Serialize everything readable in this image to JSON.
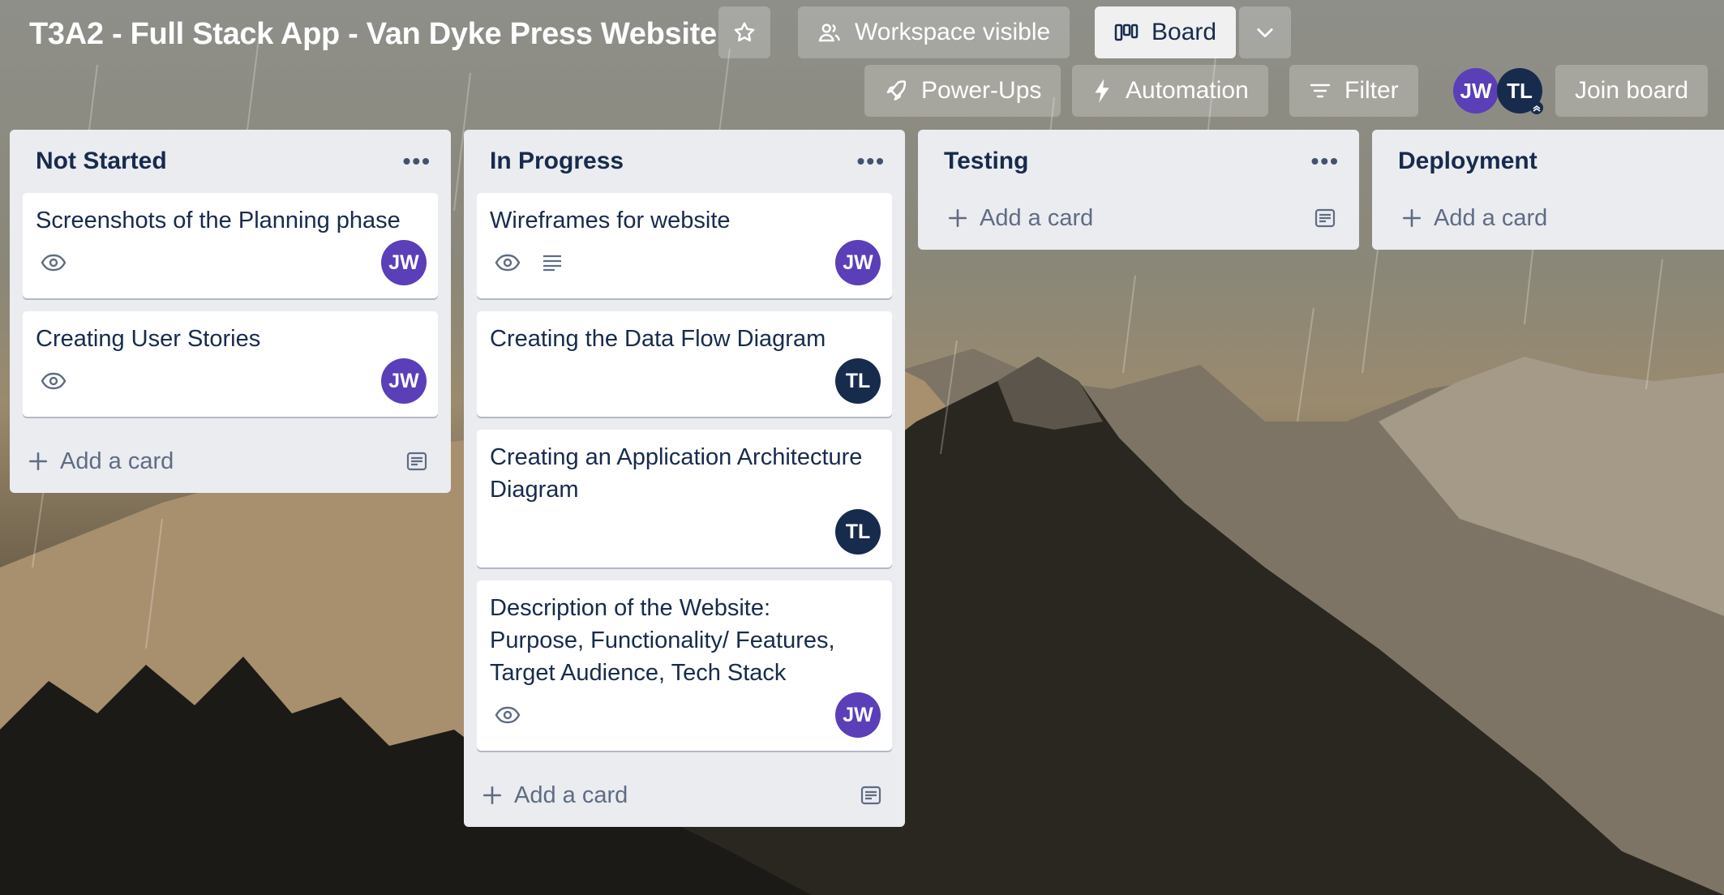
{
  "board": {
    "title": "T3A2 - Full Stack App - Van Dyke Press Website"
  },
  "header": {
    "star_icon": "star-icon",
    "visibility_label": "Workspace visible",
    "view_label": "Board",
    "powerups_label": "Power-Ups",
    "automation_label": "Automation",
    "filter_label": "Filter",
    "join_label": "Join board",
    "members": [
      "JW",
      "TL"
    ]
  },
  "lists": [
    {
      "title": "Not Started",
      "cards": [
        {
          "title": "Screenshots of the Planning phase",
          "watch": true,
          "description": false,
          "member": "JW"
        },
        {
          "title": "Creating User Stories",
          "watch": true,
          "description": false,
          "member": "JW"
        }
      ],
      "add_label": "Add a card"
    },
    {
      "title": "In Progress",
      "cards": [
        {
          "title": "Wireframes for website",
          "watch": true,
          "description": true,
          "member": "JW"
        },
        {
          "title": "Creating the Data Flow Diagram",
          "watch": false,
          "description": false,
          "member": "TL"
        },
        {
          "title": "Creating an Application Architecture Diagram",
          "watch": false,
          "description": false,
          "member": "TL"
        },
        {
          "title": "Description of the Website: Purpose, Functionality/ Features, Target Audience, Tech Stack",
          "watch": true,
          "description": false,
          "member": "JW"
        }
      ],
      "add_label": "Add a card"
    },
    {
      "title": "Testing",
      "cards": [],
      "add_label": "Add a card"
    },
    {
      "title": "Deployment",
      "cards": [],
      "add_label": "Add a card"
    }
  ],
  "colors": {
    "list_bg": "#ebecf0",
    "member_jw": "#5a3fb8",
    "member_tl": "#172b4d"
  }
}
